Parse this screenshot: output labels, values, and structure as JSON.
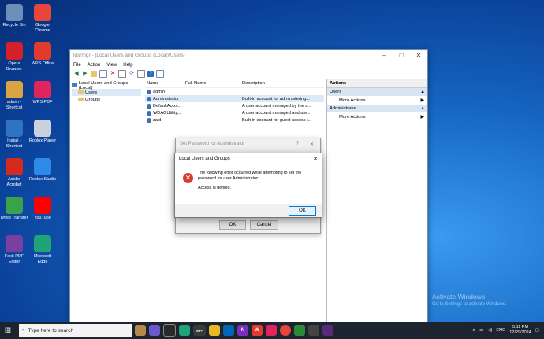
{
  "desktop_icons": [
    {
      "label": "Recycle Bin",
      "icon": "recycle-bin-icon",
      "color": "#6b8fb8"
    },
    {
      "label": "Google Chrome",
      "icon": "chrome-icon",
      "color": "#e8453c"
    },
    {
      "label": "Opera Browser",
      "icon": "opera-icon",
      "color": "#d3202b"
    },
    {
      "label": "WPS Office",
      "icon": "wps-office-icon",
      "color": "#e23a2e"
    },
    {
      "label": "admin - Shortcut",
      "icon": "folder-shortcut-icon",
      "color": "#d9a441"
    },
    {
      "label": "WPS PDF",
      "icon": "wps-pdf-icon",
      "color": "#e0245e"
    },
    {
      "label": "Install - Shortcut",
      "icon": "install-shortcut-icon",
      "color": "#2f74c0"
    },
    {
      "label": "Roblox Player",
      "icon": "roblox-icon",
      "color": "#c9d1dc"
    },
    {
      "label": "Adobe Acrobat",
      "icon": "acrobat-icon",
      "color": "#d42a20"
    },
    {
      "label": "Roblox Studio",
      "icon": "roblox-studio-icon",
      "color": "#2d8ae8"
    },
    {
      "label": "Droid Transfer",
      "icon": "droid-transfer-icon",
      "color": "#3aa24a"
    },
    {
      "label": "YouTube",
      "icon": "youtube-icon",
      "color": "#ff0000"
    },
    {
      "label": "Foxit PDF Editor",
      "icon": "foxit-icon",
      "color": "#7b3fa0"
    },
    {
      "label": "Microsoft Edge",
      "icon": "edge-icon",
      "color": "#1fa47a"
    }
  ],
  "window": {
    "title": "lusrmgr - [Local Users and Groups (Local)\\Users]",
    "menu": [
      "File",
      "Action",
      "View",
      "Help"
    ],
    "tree": {
      "root": "Local Users and Groups (Local)",
      "children": [
        "Users",
        "Groups"
      ]
    },
    "columns": [
      "Name",
      "Full Name",
      "Description"
    ],
    "rows": [
      {
        "name": "admin",
        "full_name": "",
        "description": ""
      },
      {
        "name": "Administrator",
        "full_name": "",
        "description": "Built-in account for administering..."
      },
      {
        "name": "DefaultAcco...",
        "full_name": "",
        "description": "A user account managed by the s..."
      },
      {
        "name": "WDAGUtility...",
        "full_name": "",
        "description": "A user account managed and use..."
      },
      {
        "name": "zaid",
        "full_name": "",
        "description": "Built-in account for guest access t..."
      }
    ],
    "actions": {
      "header": "Actions",
      "sections": [
        {
          "title": "Users",
          "item": "More Actions"
        },
        {
          "title": "Administrator",
          "item": "More Actions"
        }
      ]
    }
  },
  "set_password_dialog": {
    "title": "Set Password for Administrator",
    "ok": "OK",
    "cancel": "Cancel"
  },
  "error_dialog": {
    "title": "Local Users and Groups",
    "message": "The following error occurred while attempting to set the password for user Administrator:",
    "detail": "Access is denied.",
    "ok": "OK"
  },
  "watermark": {
    "line1": "Activate Windows",
    "line2": "Go to Settings to activate Windows."
  },
  "taskbar": {
    "search_placeholder": "Type here to search",
    "badge": "99+",
    "tray_lang": "ENG",
    "time": "5:11 PM",
    "date": "12/29/2024"
  }
}
